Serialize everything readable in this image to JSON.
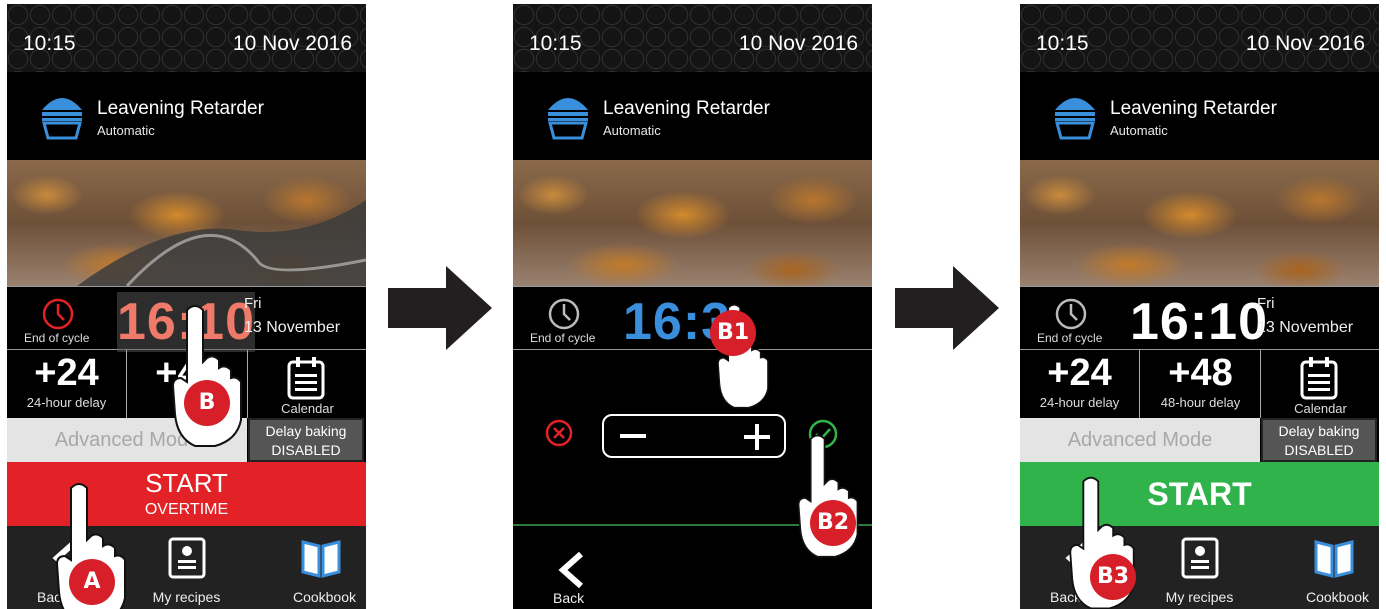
{
  "status_bar": {
    "time": "10:15",
    "date": "10 Nov 2016"
  },
  "program": {
    "name": "Leavening Retarder",
    "mode": "Automatic"
  },
  "end_of_cycle": {
    "label": "End of cycle",
    "time": "16:10",
    "time_edit": "16:3",
    "day": "Fri",
    "date": "13 November"
  },
  "delays": [
    {
      "value": "+24",
      "label": "24-hour delay"
    },
    {
      "value": "+48",
      "label": "48-hour delay",
      "label_obscured": "48-h"
    },
    {
      "value": "",
      "label": "Calendar"
    }
  ],
  "advanced_mode": "Advanced Mode",
  "delay_baking": {
    "line1": "Delay baking",
    "line2": "DISABLED"
  },
  "start": {
    "label": "START",
    "sub_label": "OVERTIME"
  },
  "nav": {
    "back": "Back",
    "back_obscured": "Back",
    "my_recipes": "My recipes",
    "cookbook": "Cookbook"
  },
  "steps": {
    "a": "A",
    "b": "B",
    "b1": "B1",
    "b2": "B2",
    "b3": "B3"
  },
  "colors": {
    "start_red": "#e32227",
    "start_green": "#2fb34a",
    "accent_blue": "#3a8fdc",
    "alert_red": "#e32227",
    "confirm_green": "#2fb34a",
    "badge_red": "#d61f28"
  },
  "icons": [
    "oven-icon",
    "clock-icon",
    "calendar-icon",
    "back-icon",
    "recipe-card-icon",
    "book-icon",
    "cancel-icon",
    "confirm-icon",
    "minus-icon",
    "plus-icon",
    "hand-pointer-icon",
    "arrow-right-icon"
  ]
}
